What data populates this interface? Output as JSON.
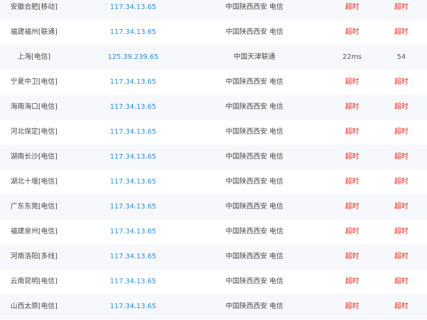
{
  "colors": {
    "ip_link": "#2b8ed8",
    "timeout": "#e8231c",
    "text": "#4a4a4a",
    "row_alt_bg": "#f7f8fb"
  },
  "rows": [
    {
      "location": "安徽合肥[移动]",
      "ip": "117.34.13.65",
      "ip_location": "中国陕西西安 电信",
      "time1": "超时",
      "time2": "超时",
      "status": "timeout"
    },
    {
      "location": "福建福州[联通]",
      "ip": "117.34.13.65",
      "ip_location": "中国陕西西安 电信",
      "time1": "超时",
      "time2": "超时",
      "status": "timeout"
    },
    {
      "location": "上海[电信]",
      "ip": "125.39.239.65",
      "ip_location": "中国天津联通",
      "time1": "22ms",
      "time2": "54",
      "status": "ok"
    },
    {
      "location": "宁夏中卫[电信]",
      "ip": "117.34.13.65",
      "ip_location": "中国陕西西安 电信",
      "time1": "超时",
      "time2": "超时",
      "status": "timeout"
    },
    {
      "location": "海南海口[电信]",
      "ip": "117.34.13.65",
      "ip_location": "中国陕西西安 电信",
      "time1": "超时",
      "time2": "超时",
      "status": "timeout"
    },
    {
      "location": "河北保定[电信]",
      "ip": "117.34.13.65",
      "ip_location": "中国陕西西安 电信",
      "time1": "超时",
      "time2": "超时",
      "status": "timeout"
    },
    {
      "location": "湖南长沙[电信]",
      "ip": "117.34.13.65",
      "ip_location": "中国陕西西安 电信",
      "time1": "超时",
      "time2": "超时",
      "status": "timeout"
    },
    {
      "location": "湖北十堰[电信]",
      "ip": "117.34.13.65",
      "ip_location": "中国陕西西安 电信",
      "time1": "超时",
      "time2": "超时",
      "status": "timeout"
    },
    {
      "location": "广东东莞[电信]",
      "ip": "117.34.13.65",
      "ip_location": "中国陕西西安 电信",
      "time1": "超时",
      "time2": "超时",
      "status": "timeout"
    },
    {
      "location": "福建泉州[电信]",
      "ip": "117.34.13.65",
      "ip_location": "中国陕西西安 电信",
      "time1": "超时",
      "time2": "超时",
      "status": "timeout"
    },
    {
      "location": "河南洛阳[多线]",
      "ip": "117.34.13.65",
      "ip_location": "中国陕西西安 电信",
      "time1": "超时",
      "time2": "超时",
      "status": "timeout"
    },
    {
      "location": "云南昆明[电信]",
      "ip": "117.34.13.65",
      "ip_location": "中国陕西西安 电信",
      "time1": "超时",
      "time2": "超时",
      "status": "timeout"
    },
    {
      "location": "山西太原[电信]",
      "ip": "117.34.13.65",
      "ip_location": "中国陕西西安 电信",
      "time1": "超时",
      "time2": "超时",
      "status": "timeout"
    }
  ]
}
